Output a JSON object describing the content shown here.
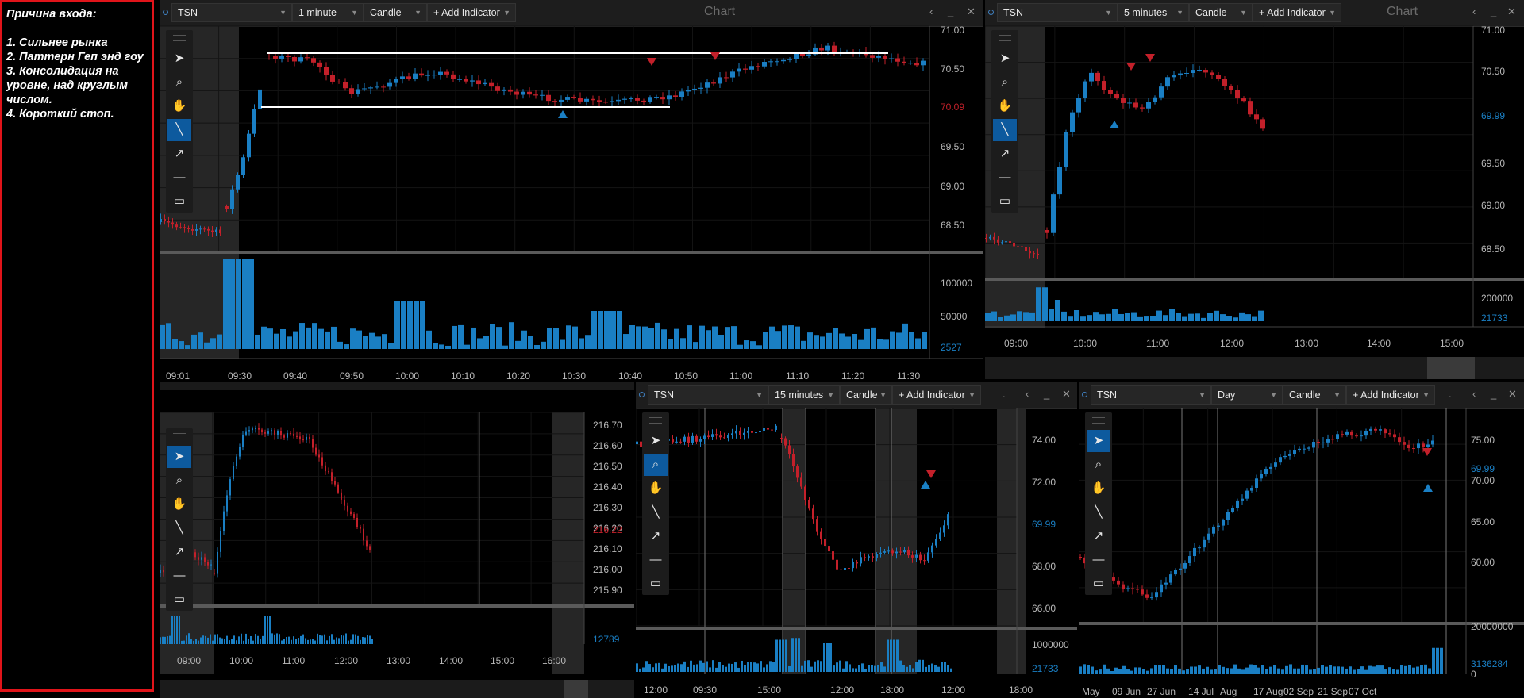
{
  "note": {
    "title": "Причина входа:",
    "items": [
      "1. Сильнее рынка",
      "2. Паттерн Геп энд гоу",
      "3. Консолидация на уровне, над круглым числом.",
      "4. Короткий стоп."
    ]
  },
  "colors": {
    "up": "#1a7fc4",
    "down": "#c3202a",
    "volume": "#1a7fc4",
    "background": "#000000",
    "accent_active": "#0d5a9e"
  },
  "toolbar_tools": [
    "arrow-pointer-icon",
    "magnifier-icon",
    "hand-pan-icon",
    "trendline-icon",
    "arrow-line-icon",
    "horizontal-line-icon",
    "rectangle-icon"
  ],
  "panels": {
    "p1": {
      "symbol": "TSN",
      "interval": "1 minute",
      "chart_type": "Candle",
      "add_indicator": "+ Add Indicator",
      "chart_label": "Chart",
      "price_ticks": [
        "71.00",
        "70.50",
        "70.00",
        "69.50",
        "69.00",
        "68.50"
      ],
      "current_price": "70.09",
      "volume_ticks": [
        "100000",
        "50000"
      ],
      "volume_current": "2527",
      "time_ticks": [
        "09:01",
        "09:30",
        "09:40",
        "09:50",
        "10:00",
        "10:10",
        "10:20",
        "10:30",
        "10:40",
        "10:50",
        "11:00",
        "11:10",
        "11:20",
        "11:30"
      ]
    },
    "p2": {
      "symbol": "TSN",
      "interval": "5 minutes",
      "chart_type": "Candle",
      "add_indicator": "+ Add Indicator",
      "chart_label": "Chart",
      "price_ticks": [
        "71.00",
        "70.50",
        "70.00",
        "69.50",
        "69.00",
        "68.50"
      ],
      "current_price": "69.99",
      "volume_ticks": [
        "200000"
      ],
      "volume_current": "21733",
      "time_ticks": [
        "09:00",
        "10:00",
        "11:00",
        "12:00",
        "13:00",
        "14:00",
        "15:00"
      ]
    },
    "p3": {
      "price_ticks": [
        "216.70",
        "216.60",
        "216.50",
        "216.40",
        "216.30",
        "216.20",
        "216.10",
        "216.00",
        "215.90"
      ],
      "current_price": "216.22",
      "volume_current": "12789",
      "time_ticks": [
        "09:00",
        "10:00",
        "11:00",
        "12:00",
        "13:00",
        "14:00",
        "15:00",
        "16:00"
      ]
    },
    "p4": {
      "symbol": "TSN",
      "interval": "15 minutes",
      "chart_type": "Candle",
      "add_indicator": "+ Add Indicator",
      "more": ".",
      "price_ticks": [
        "74.00",
        "72.00",
        "70.00",
        "68.00",
        "66.00"
      ],
      "current_price": "69.99",
      "volume_ticks": [
        "1000000"
      ],
      "volume_current": "21733",
      "time_ticks": [
        "12:00",
        "09:30",
        "15:00",
        "12:00",
        "18:00",
        "12:00",
        "18:00"
      ]
    },
    "p5": {
      "symbol": "TSN",
      "interval": "Day",
      "chart_type": "Candle",
      "add_indicator": "+ Add Indicator",
      "more": ".",
      "price_ticks": [
        "75.00",
        "70.00",
        "65.00",
        "60.00"
      ],
      "current_price": "69.99",
      "volume_ticks": [
        "20000000"
      ],
      "volume_current": "3136284",
      "volume_zero": "0",
      "time_ticks": [
        "May",
        "09 Jun",
        "27 Jun",
        "14 Jul",
        "Aug",
        "17 Aug",
        "02 Sep",
        "21 Sep",
        "07 Oct"
      ]
    }
  }
}
